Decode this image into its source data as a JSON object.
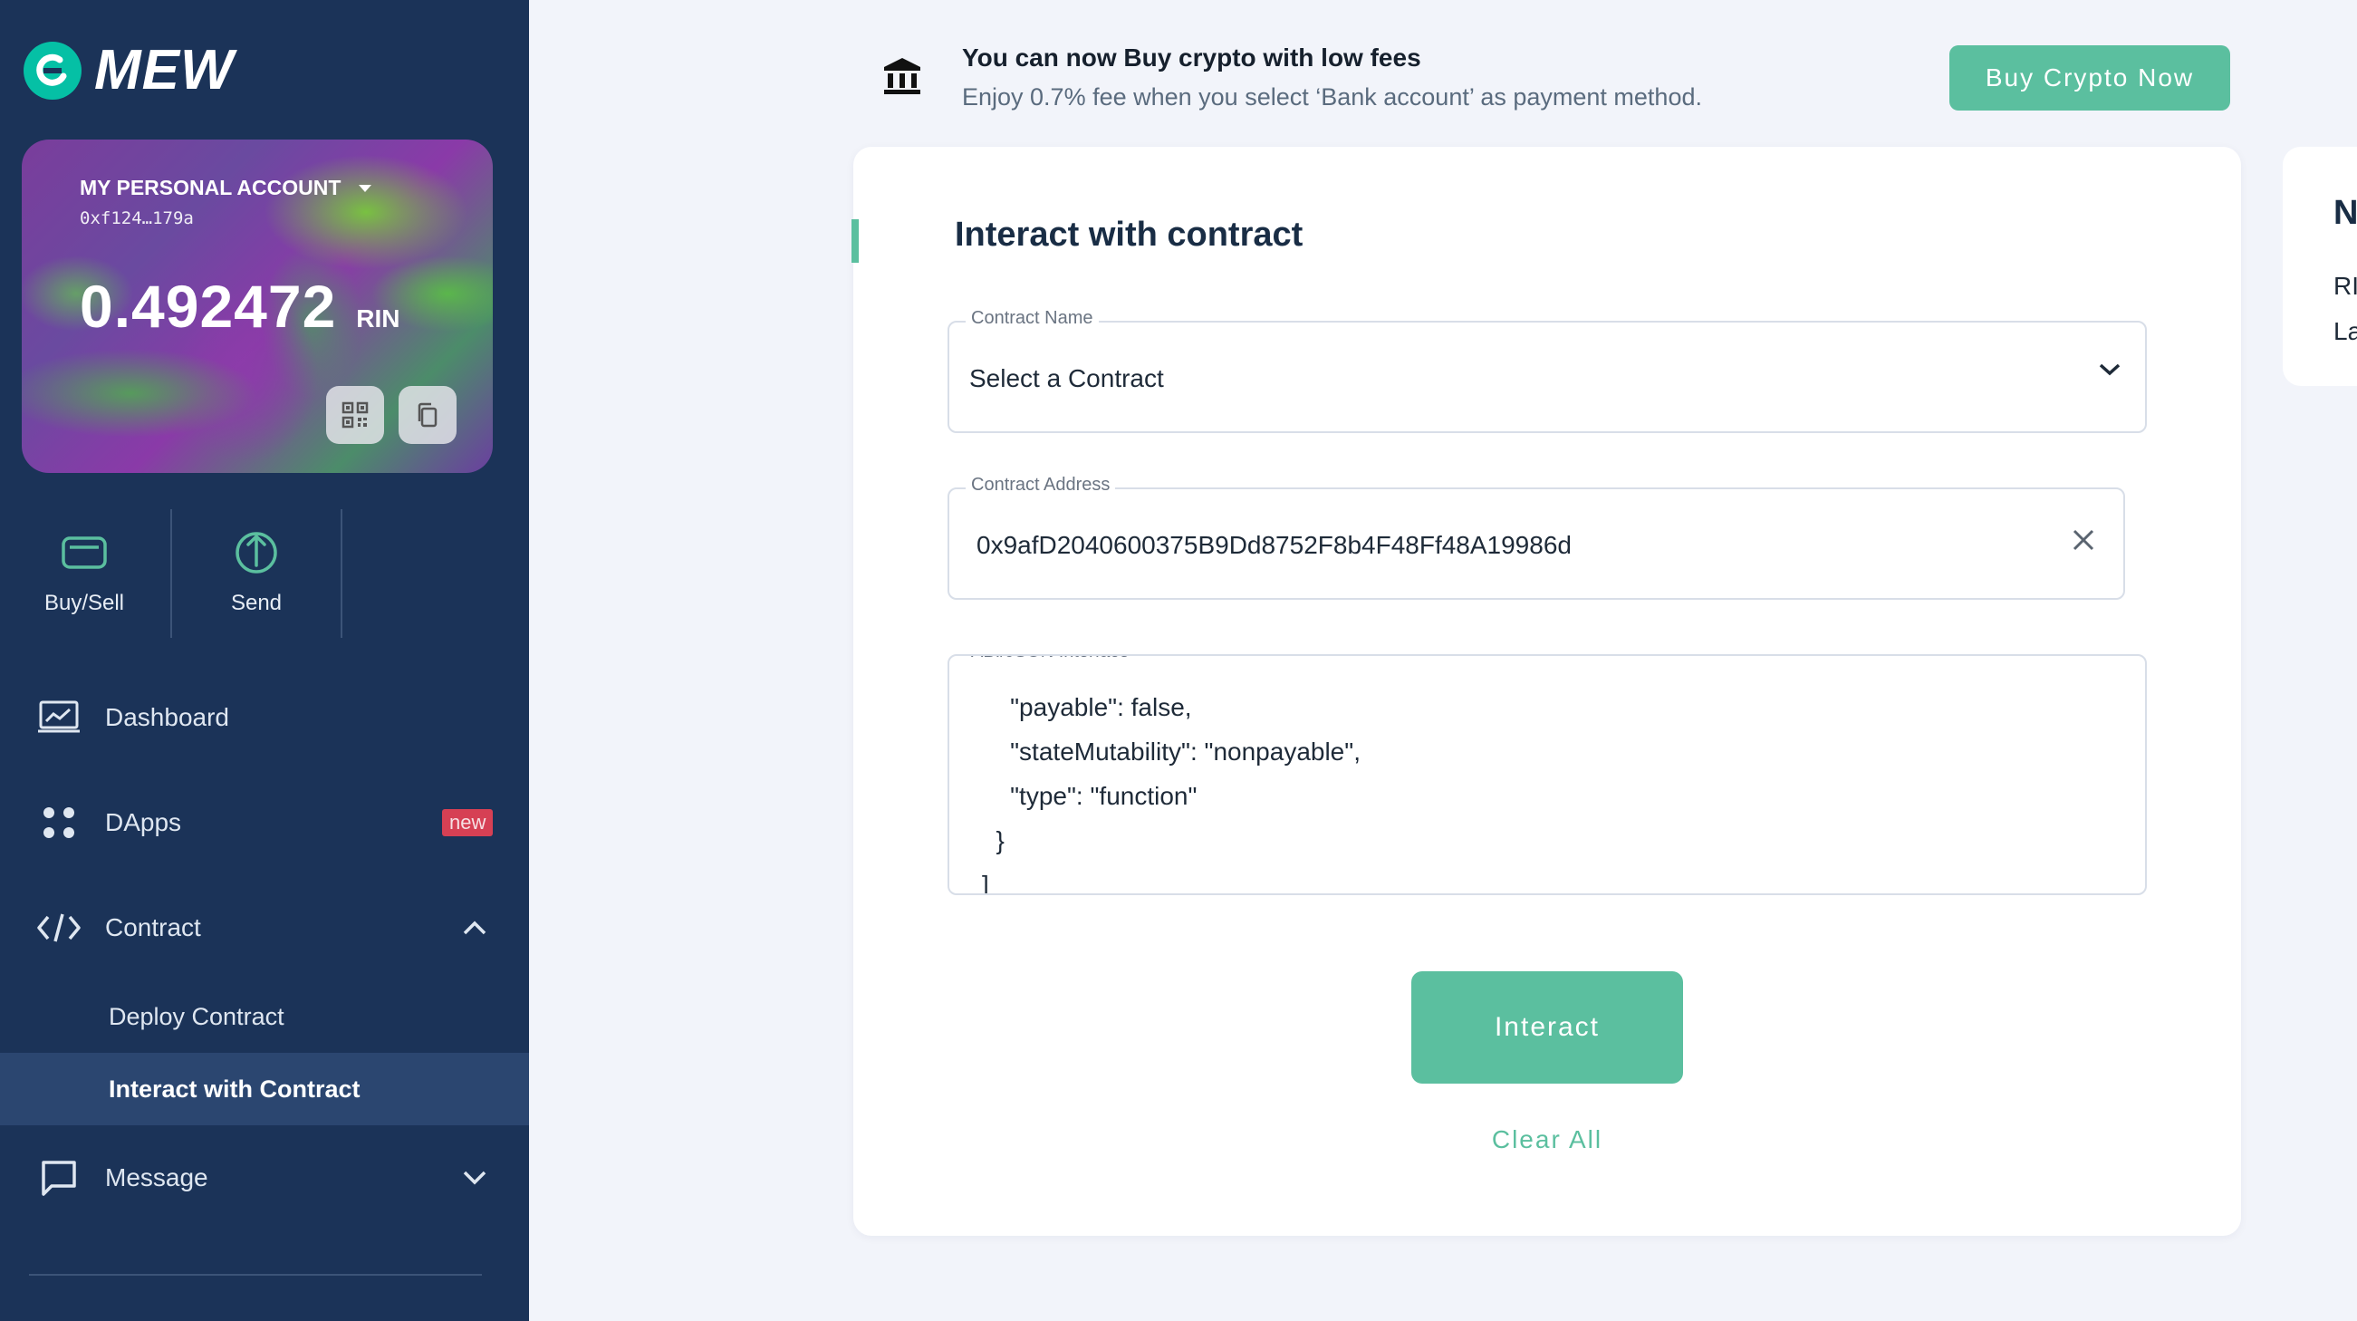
{
  "brand": {
    "name": "MEW"
  },
  "account": {
    "name": "MY PERSONAL ACCOUNT",
    "address": "0xf124…179a",
    "balance": "0.492472",
    "unit": "RIN"
  },
  "quick_actions": [
    {
      "label": "Buy/Sell",
      "icon": "card-icon"
    },
    {
      "label": "Send",
      "icon": "send-icon"
    }
  ],
  "nav": {
    "dashboard": "Dashboard",
    "dapps": "DApps",
    "dapps_badge": "new",
    "contract": "Contract",
    "deploy_contract": "Deploy Contract",
    "interact_contract": "Interact with Contract",
    "message": "Message"
  },
  "banner": {
    "title": "You can now Buy crypto with low fees",
    "subtitle": "Enjoy 0.7% fee when you select ‘Bank account’ as payment method.",
    "button": "Buy Crypto Now"
  },
  "form": {
    "title": "Interact with contract",
    "contract_name_label": "Contract Name",
    "contract_name_value": "Select a Contract",
    "contract_address_label": "Contract Address",
    "contract_address_value": "0x9afD2040600375B9Dd8752F8b4F48Ff48A19986d",
    "abi_label": "ABI/JSON Interface",
    "abi_lines": [
      "    \"payable\": false,",
      "    \"stateMutability\": \"nonpayable\",",
      "    \"type\": \"function\"",
      "  }",
      "]"
    ],
    "interact_button": "Interact",
    "clear_all": "Clear All"
  },
  "side_card": {
    "title": "N",
    "line1": "RI",
    "line2": "La"
  },
  "colors": {
    "sidebar_bg": "#1b3358",
    "accent": "#5bbf9f",
    "badge": "#d64054",
    "page_bg": "#f2f4fa"
  }
}
